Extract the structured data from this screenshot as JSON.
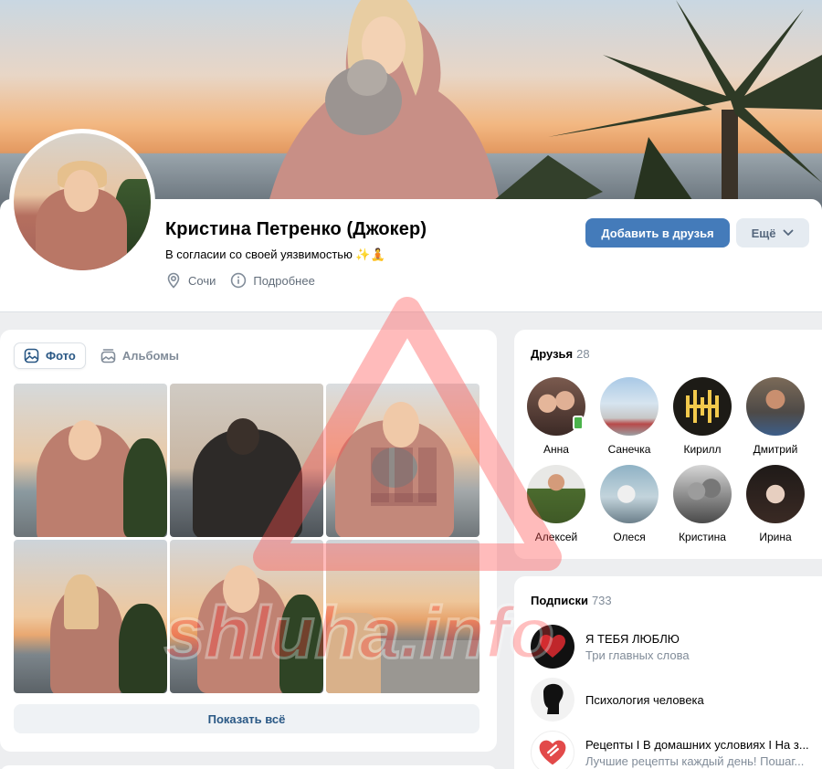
{
  "profile": {
    "name": "Кристина Петренко (Джокер)",
    "status": "В согласии со своей уязвимостью ✨🧘",
    "city": "Сочи",
    "details": "Подробнее",
    "add_friend": "Добавить в друзья",
    "more": "Ещё"
  },
  "photos": {
    "tabs": [
      {
        "label": "Фото",
        "active": true,
        "icon": "image-icon"
      },
      {
        "label": "Альбомы",
        "active": false,
        "icon": "albums-icon"
      }
    ],
    "show_all": "Показать всё"
  },
  "friends": {
    "title": "Друзья",
    "count": "28",
    "items": [
      {
        "name": "Анна"
      },
      {
        "name": "Санечка"
      },
      {
        "name": "Кирилл"
      },
      {
        "name": "Дмитрий"
      },
      {
        "name": "Алексей"
      },
      {
        "name": "Олеся"
      },
      {
        "name": "Кристина"
      },
      {
        "name": "Ирина"
      }
    ]
  },
  "subscriptions": {
    "title": "Подписки",
    "count": "733",
    "items": [
      {
        "title": "Я ТЕБЯ ЛЮБЛЮ",
        "subtitle": "Три главных слова"
      },
      {
        "title": "Психология человека",
        "subtitle": ""
      },
      {
        "title": "Рецепты I В домашних условиях I На з...",
        "subtitle": "Лучшие рецепты каждый день! Пошаг..."
      }
    ]
  },
  "watermark": {
    "text": "shluha.info",
    "color": "#ff3b3b"
  },
  "colors": {
    "accent": "#447bba",
    "link": "#2a5885",
    "background": "#edeef0",
    "muted": "#818c99"
  }
}
